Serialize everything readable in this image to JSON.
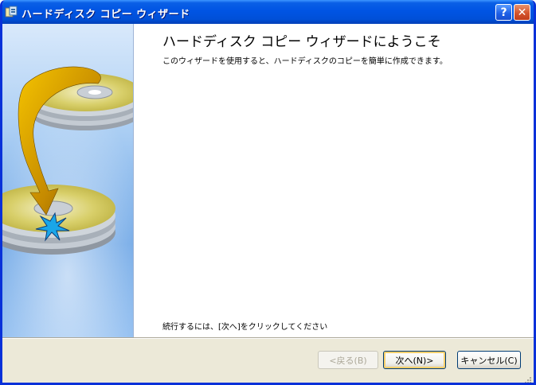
{
  "window": {
    "title": "ハードディスク コピー ウィザード",
    "help_label": "?",
    "close_label": "✕"
  },
  "content": {
    "heading": "ハードディスク コピー ウィザードにようこそ",
    "description": "このウィザードを使用すると、ハードディスクのコピーを簡単に作成できます。",
    "continue_hint": "続行するには、[次へ]をクリックしてください"
  },
  "buttons": {
    "back": "<戻る(B)",
    "next": "次へ(N)>",
    "cancel": "キャンセル(C)"
  }
}
